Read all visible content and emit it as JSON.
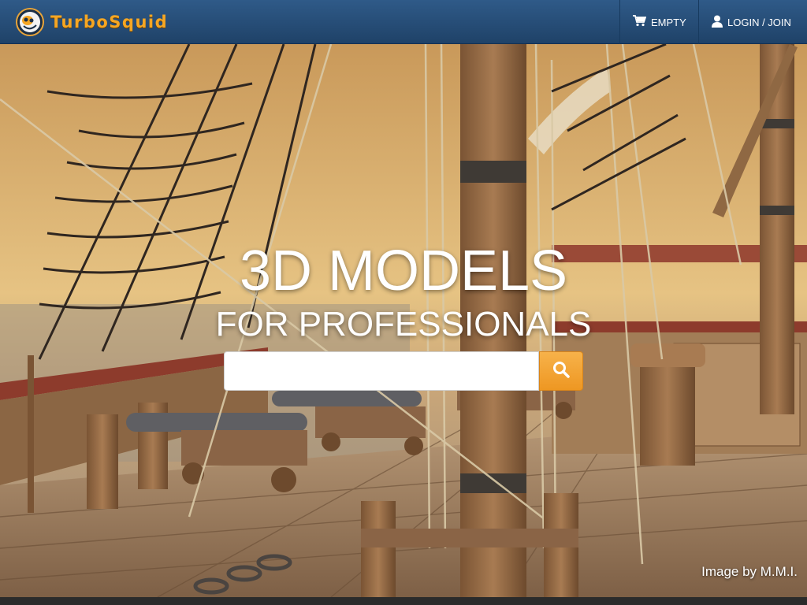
{
  "brand": {
    "name": "TurboSquid"
  },
  "nav": {
    "cart_label": "EMPTY",
    "login_label": "LOGIN / JOIN"
  },
  "hero": {
    "headline": "3D MODELS",
    "subheadline": "FOR PROFESSIONALS",
    "search_placeholder": "",
    "image_credit": "Image by M.M.I."
  },
  "icons": {
    "logo": "turbosquid-logo-icon",
    "cart": "shopping-cart-icon",
    "user": "user-icon",
    "search": "search-icon"
  },
  "colors": {
    "nav_bg": "#2a5080",
    "brand_orange": "#f5a623",
    "search_button": "#f2a234"
  }
}
